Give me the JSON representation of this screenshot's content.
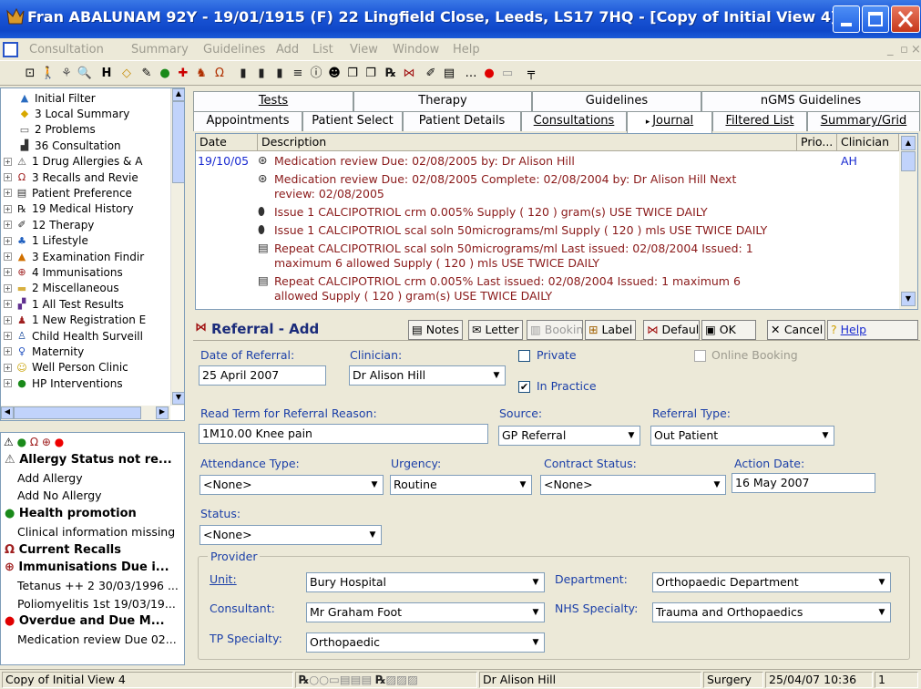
{
  "window": {
    "title": "Fran ABALUNAM 92Y - 19/01/1915 (F)  22 Lingfield Close, Leeds, LS17 7HQ - [Copy of Initial View 4]"
  },
  "menu": [
    "Consultation",
    "Summary",
    "Guidelines",
    "Add",
    "List",
    "View",
    "Window",
    "Help"
  ],
  "toolbar_icons": [
    "new-icon",
    "walk-icon",
    "ladies-icon",
    "search-icon",
    "h-icon",
    "diamond-icon",
    "pen-icon",
    "apple-icon",
    "plus-icon",
    "walk2-icon",
    "stethoscope-icon",
    "book-icon",
    "book2-icon",
    "book3-icon",
    "list-icon",
    "info-icon",
    "face-icon",
    "copy-icon",
    "copy2-icon",
    "rx-icon",
    "bow-icon",
    "pencil-icon",
    "doc-icon",
    "ellipsis-icon",
    "red-circle-icon",
    "bar-icon",
    "pin-icon"
  ],
  "tree": [
    {
      "label": "Initial Filter",
      "icon": "filter-icon",
      "pm": ""
    },
    {
      "label": "3 Local Summary",
      "icon": "diamond-icon",
      "pm": ""
    },
    {
      "label": "2 Problems",
      "icon": "problem-icon",
      "pm": ""
    },
    {
      "label": "36 Consultation",
      "icon": "consultation-icon",
      "pm": ""
    },
    {
      "label": "1 Drug Allergies & A",
      "icon": "allergy-icon",
      "pm": "+"
    },
    {
      "label": "3 Recalls and Revie",
      "icon": "recall-icon",
      "pm": "+"
    },
    {
      "label": "Patient Preference",
      "icon": "document-icon",
      "pm": "+"
    },
    {
      "label": "19 Medical History",
      "icon": "rx-icon",
      "pm": "+"
    },
    {
      "label": "12 Therapy",
      "icon": "pencil-icon",
      "pm": "+"
    },
    {
      "label": "1 Lifestyle",
      "icon": "lifestyle-icon",
      "pm": "+"
    },
    {
      "label": "3 Examination Findir",
      "icon": "chart-icon",
      "pm": "+"
    },
    {
      "label": "4 Immunisations",
      "icon": "immunisation-icon",
      "pm": "+"
    },
    {
      "label": "2 Miscellaneous",
      "icon": "folder-icon",
      "pm": "+"
    },
    {
      "label": "1 All Test Results",
      "icon": "test-icon",
      "pm": "+"
    },
    {
      "label": "1 New Registration E",
      "icon": "registration-icon",
      "pm": "+"
    },
    {
      "label": "Child Health Surveill",
      "icon": "child-icon",
      "pm": "+"
    },
    {
      "label": "Maternity",
      "icon": "maternity-icon",
      "pm": "+"
    },
    {
      "label": "Well Person Clinic",
      "icon": "smiley-icon",
      "pm": "+"
    },
    {
      "label": "HP Interventions",
      "icon": "apple-icon",
      "pm": "+"
    }
  ],
  "alerts": [
    {
      "text": "Allergy Status not re...",
      "head": true,
      "icon": "allergy-icon"
    },
    {
      "text": "Add Allergy",
      "head": false
    },
    {
      "text": "Add No Allergy",
      "head": false
    },
    {
      "text": "Health promotion",
      "head": true,
      "icon": "apple-icon"
    },
    {
      "text": "Clinical information missing",
      "head": false
    },
    {
      "text": "Current Recalls",
      "head": true,
      "icon": "recall-icon"
    },
    {
      "text": "Immunisations Due i...",
      "head": true,
      "icon": "immunisation-icon"
    },
    {
      "text": "Tetanus ++ 2 30/03/1996 ...",
      "head": false
    },
    {
      "text": "Poliomyelitis 1st 19/03/19...",
      "head": false
    },
    {
      "text": "Overdue and Due M...",
      "head": true,
      "icon": "apple-red-icon"
    },
    {
      "text": "Medication review Due 02...",
      "head": false
    }
  ],
  "tabs_row1": [
    "Tests",
    "Therapy",
    "Guidelines",
    "nGMS Guidelines"
  ],
  "tabs_row2": [
    "Appointments",
    "Patient Select",
    "Patient Details",
    "Consultations",
    "Journal",
    "Filtered List",
    "Summary/Grid"
  ],
  "journal": {
    "headers": [
      "Date",
      "Description",
      "Prio...",
      "Clinician"
    ],
    "date": "19/10/05",
    "clinician": "AH",
    "lines": [
      "Medication review  Due: 02/08/2005  by: Dr Alison Hill",
      "Medication review  Due: 02/08/2005 Complete: 02/08/2004  by: Dr Alison Hill  Next",
      "review: 02/08/2005",
      "Issue 1 CALCIPOTRIOL crm 0.005%  Supply ( 120 ) gram(s)  USE TWICE DAILY",
      "Issue 1 CALCIPOTRIOL scal soln 50micrograms/ml  Supply ( 120 ) mls  USE TWICE DAILY",
      "Repeat  CALCIPOTRIOL scal soln 50micrograms/ml  Last issued: 02/08/2004  Issued: 1",
      "maximum  6  allowed  Supply ( 120 ) mls  USE TWICE DAILY",
      "Repeat  CALCIPOTRIOL crm 0.005%  Last issued: 02/08/2004  Issued: 1  maximum  6",
      "allowed  Supply ( 120 ) gram(s)  USE TWICE DAILY"
    ]
  },
  "referral": {
    "title": "Referral - Add",
    "buttons": {
      "notes": "Notes",
      "letter": "Letter",
      "booking": "Bookin",
      "label": "Label",
      "default": "Defaul",
      "ok": "OK",
      "cancel": "Cancel",
      "help": "Help"
    },
    "labels": {
      "date": "Date of Referral:",
      "clinician": "Clinician:",
      "private": "Private",
      "in_practice": "In Practice",
      "online": "Online Booking",
      "read_term": "Read Term for Referral Reason:",
      "source": "Source:",
      "ref_type": "Referral Type:",
      "attendance": "Attendance Type:",
      "urgency": "Urgency:",
      "contract": "Contract Status:",
      "action_date": "Action Date:",
      "status": "Status:",
      "provider": "Provider",
      "unit": "Unit:",
      "department": "Department:",
      "consultant": "Consultant:",
      "nhs_specialty": "NHS Specialty:",
      "tp_specialty": "TP Specialty:"
    },
    "values": {
      "date": "25 April 2007",
      "clinician": "Dr Alison Hill",
      "read_term": "1M10.00  Knee pain",
      "source": "GP Referral",
      "ref_type": "Out Patient",
      "attendance": "<None>",
      "urgency": "Routine",
      "contract": "<None>",
      "action_date": "16 May 2007",
      "status": "<None>",
      "unit": "Bury Hospital",
      "department": "Orthopaedic Department",
      "consultant": "Mr Graham Foot",
      "nhs_specialty": "Trauma and Orthopaedics",
      "tp_specialty": "Orthopaedic"
    }
  },
  "statusbar": {
    "left": "Copy of Initial View 4",
    "user": "Dr Alison Hill",
    "location": "Surgery",
    "datetime": "25/04/07 10:36",
    "count": "1"
  }
}
